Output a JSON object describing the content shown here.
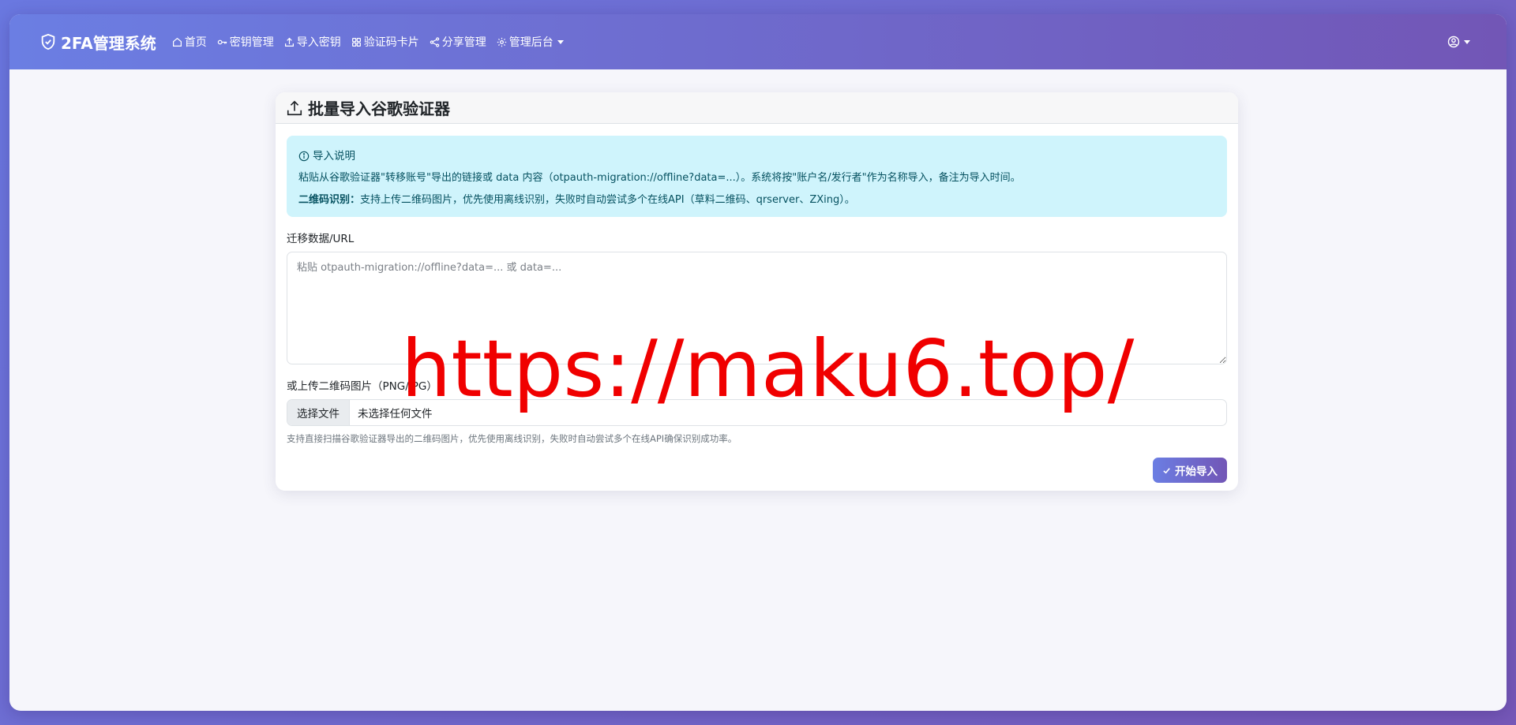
{
  "navbar": {
    "brand": "2FA管理系统",
    "items": [
      {
        "label": "首页",
        "icon": "home-icon"
      },
      {
        "label": "密钥管理",
        "icon": "key-icon"
      },
      {
        "label": "导入密钥",
        "icon": "upload-icon"
      },
      {
        "label": "验证码卡片",
        "icon": "grid-icon"
      },
      {
        "label": "分享管理",
        "icon": "share-icon"
      },
      {
        "label": "管理后台",
        "icon": "gear-icon",
        "dropdown": true
      }
    ],
    "user_icon": "user-circle-icon"
  },
  "card": {
    "title": "批量导入谷歌验证器",
    "alert": {
      "title": "导入说明",
      "line1": "粘贴从谷歌验证器\"转移账号\"导出的链接或 data 内容（otpauth-migration://offline?data=...）。系统将按\"账户名/发行者\"作为名称导入，备注为导入时间。",
      "line2_bold": "二维码识别：",
      "line2_text": "支持上传二维码图片，优先使用离线识别，失败时自动尝试多个在线API（草料二维码、qrserver、ZXing）。"
    },
    "migration_label": "迁移数据/URL",
    "migration_placeholder": "粘贴 otpauth-migration://offline?data=... 或 data=...",
    "upload_label": "或上传二维码图片（PNG/JPG）",
    "file_button": "选择文件",
    "file_status": "未选择任何文件",
    "help_text": "支持直接扫描谷歌验证器导出的二维码图片，优先使用离线识别，失败时自动尝试多个在线API确保识别成功率。",
    "submit_label": "开始导入"
  },
  "watermark": "https://maku6.top/",
  "colors": {
    "accent_start": "#6b7ee3",
    "accent_end": "#7256b6",
    "alert_bg": "#cff4fc",
    "alert_text": "#055160",
    "watermark": "#f00000"
  }
}
